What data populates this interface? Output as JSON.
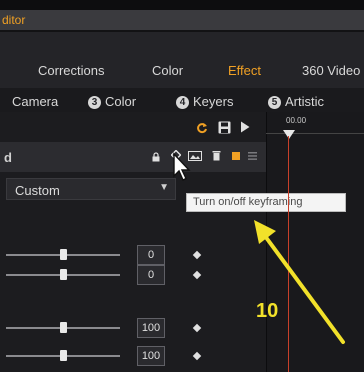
{
  "window": {
    "title": "ditor"
  },
  "tabs": [
    "Corrections",
    "Color",
    "Effect",
    "360 Video"
  ],
  "active_tab": "Effect",
  "categories": [
    {
      "number": "",
      "label": "Camera"
    },
    {
      "number": "3",
      "label": "Color"
    },
    {
      "number": "4",
      "label": "Keyers"
    },
    {
      "number": "5",
      "label": "Artistic"
    }
  ],
  "section": {
    "header": "d"
  },
  "preset": {
    "value": "Custom"
  },
  "tooltip": {
    "text": "Turn on/off keyframing"
  },
  "rows": [
    {
      "value": "0",
      "level": 0.4
    },
    {
      "value": "0",
      "level": 0.4
    },
    {
      "value": "100",
      "level": 0.4
    },
    {
      "value": "100",
      "level": 0.4
    }
  ],
  "timeline": {
    "timecode": "00.00"
  },
  "annotation": {
    "label": "10",
    "color": "#f2e12a"
  },
  "colors": {
    "accent": "#f0a024",
    "playhead": "#c8402a"
  },
  "icons": [
    "loop-icon",
    "save-icon",
    "play-icon",
    "lock-icon",
    "keyframe-toggle-icon",
    "image-icon",
    "trash-icon",
    "color-swatch-icon",
    "menu-icon",
    "cursor-icon",
    "arrow-annotation"
  ]
}
